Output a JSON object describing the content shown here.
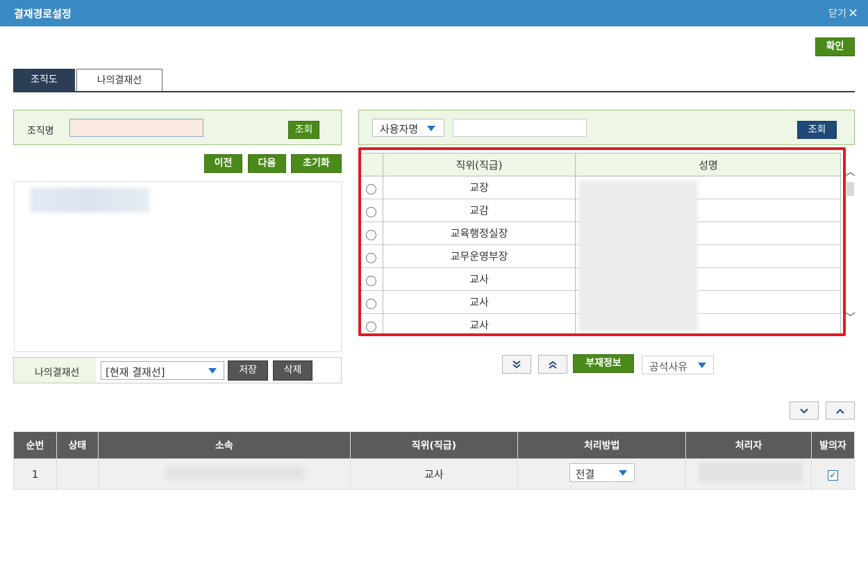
{
  "titlebar": {
    "title": "결재경로설정",
    "close_label": "닫기",
    "close_icon": "✕"
  },
  "confirm_label": "확인",
  "tabs": [
    {
      "label": "조직도",
      "active": true
    },
    {
      "label": "나의결재선",
      "active": false
    }
  ],
  "org_search": {
    "label": "조직명",
    "value": "",
    "search_label": "조회"
  },
  "nav_buttons": {
    "prev": "이전",
    "next": "다음",
    "reset": "초기화"
  },
  "my_approval_line": {
    "label": "나의결재선",
    "selected": "[현재 결재선]",
    "save": "저장",
    "delete": "삭제"
  },
  "user_search": {
    "field_select": "사용자명",
    "value": "",
    "search_label": "조회"
  },
  "user_grid": {
    "headers": {
      "position": "직위(직급)",
      "name": "성명"
    },
    "rows": [
      {
        "position": "교장"
      },
      {
        "position": "교감"
      },
      {
        "position": "교육행정실장"
      },
      {
        "position": "교무운영부장"
      },
      {
        "position": "교사"
      },
      {
        "position": "교사"
      },
      {
        "position": "교사"
      }
    ]
  },
  "transfer": {
    "add_icon": "double-chevron-down-icon",
    "remove_icon": "double-chevron-up-icon",
    "absence_label": "부재정보",
    "absence_reason_select": "공석사유"
  },
  "order": {
    "down_icon": "chevron-down-icon",
    "up_icon": "chevron-up-icon"
  },
  "approval_table": {
    "headers": {
      "order": "순번",
      "status": "상태",
      "dept": "소속",
      "position": "직위(직급)",
      "method": "처리방법",
      "processor": "처리자",
      "drafter": "발의자"
    },
    "rows": [
      {
        "order": "1",
        "status": "",
        "position": "교사",
        "method": "전결",
        "drafter_checked": true
      }
    ]
  },
  "colors": {
    "titlebar": "#3a8ac4",
    "green_button": "#4a8a1a",
    "navy_button": "#1f4a78",
    "highlight_border": "#e01b26"
  }
}
